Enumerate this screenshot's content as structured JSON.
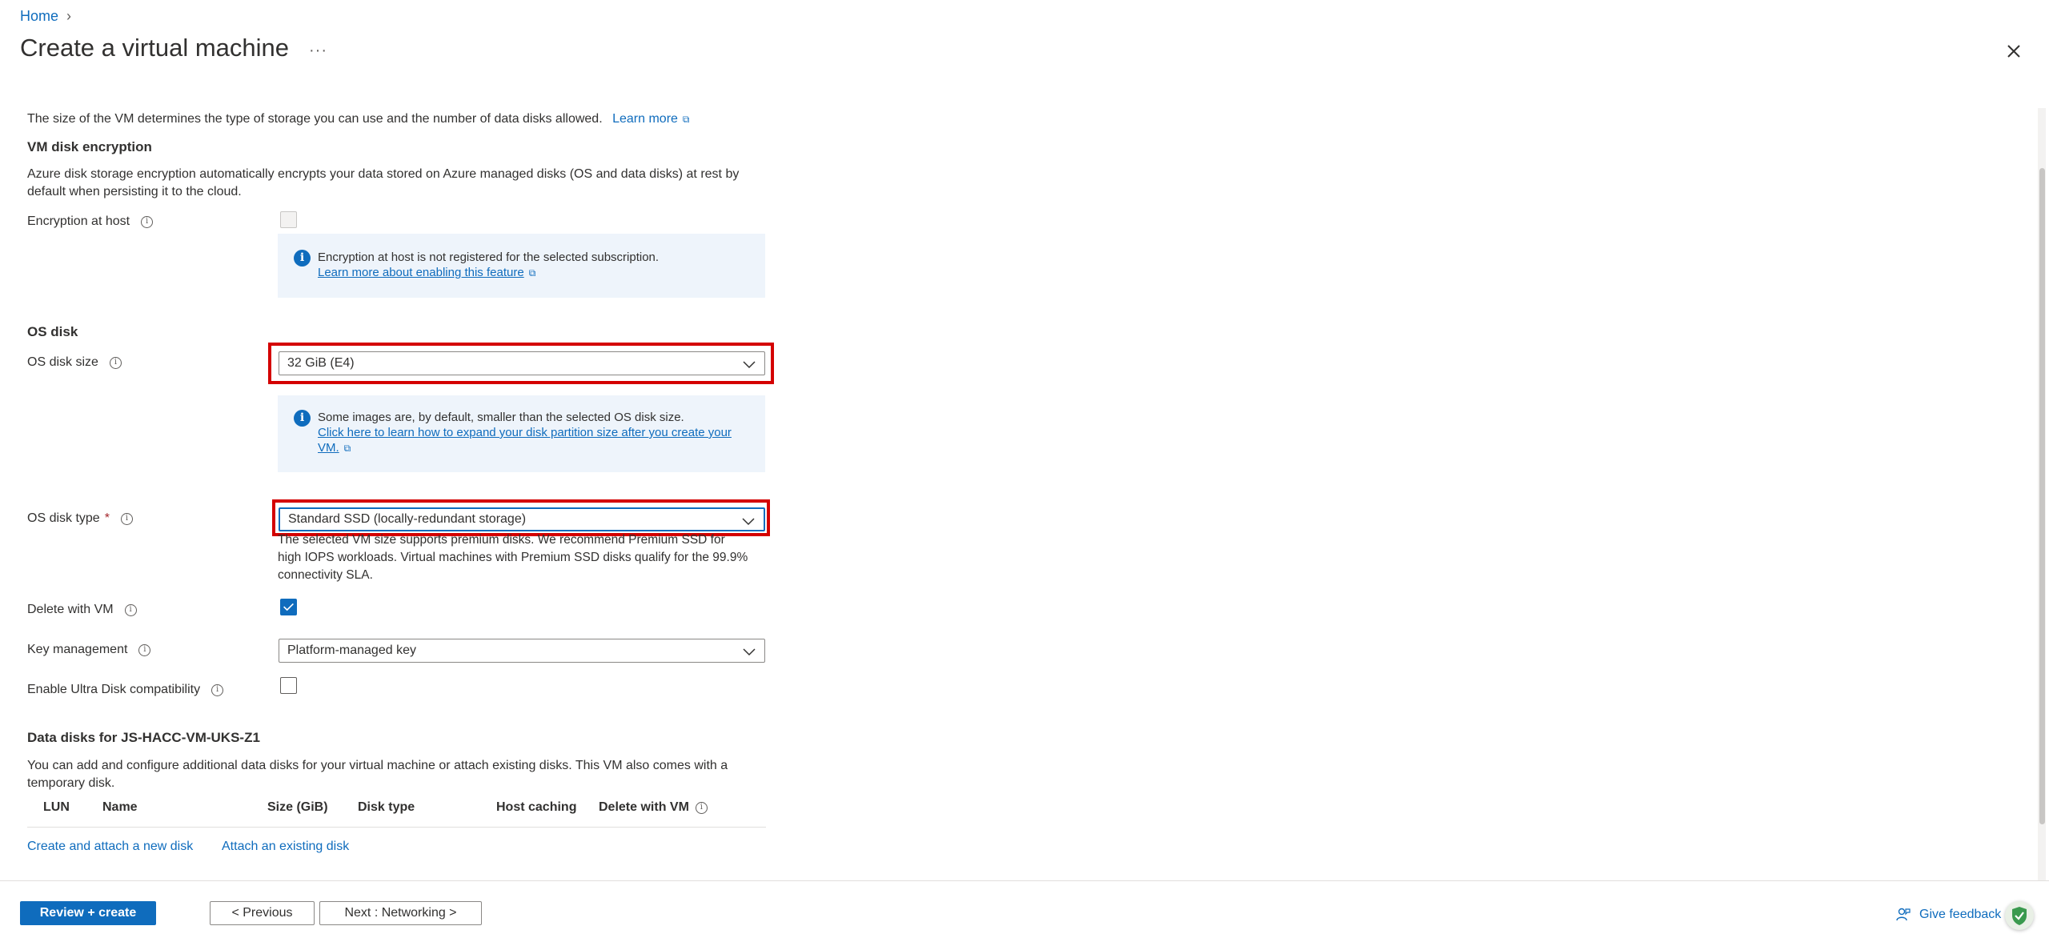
{
  "breadcrumb": {
    "home": "Home"
  },
  "page": {
    "title": "Create a virtual machine",
    "more": "···"
  },
  "intro": {
    "text": "The size of the VM determines the type of storage you can use and the number of data disks allowed.",
    "learn_more": "Learn more"
  },
  "encryption": {
    "heading": "VM disk encryption",
    "desc_line1": "Azure disk storage encryption automatically encrypts your data stored on Azure managed disks (OS and data disks) at rest by",
    "desc_line2": "default when persisting it to the cloud.",
    "host_label": "Encryption at host",
    "info_line1": "Encryption at host is not registered for the selected subscription.",
    "info_link": "Learn more about enabling this feature"
  },
  "os_disk": {
    "heading": "OS disk",
    "size_label": "OS disk size",
    "size_value": "32 GiB (E4)",
    "size_info_line1": "Some images are, by default, smaller than the selected OS disk size.",
    "size_info_link1": "Click here to learn how to expand your disk partition size after you create your",
    "size_info_link2": "VM.",
    "type_label": "OS disk type",
    "type_required": "*",
    "type_value": "Standard SSD (locally-redundant storage)",
    "type_note1": "The selected VM size supports premium disks. We recommend Premium SSD for",
    "type_note2": "high IOPS workloads. Virtual machines with Premium SSD disks qualify for the 99.9%",
    "type_note3": "connectivity SLA.",
    "delete_label": "Delete with VM",
    "delete_checked": true,
    "key_label": "Key management",
    "key_value": "Platform-managed key",
    "ultra_label": "Enable Ultra Disk compatibility",
    "ultra_checked": false
  },
  "data_disks": {
    "heading": "Data disks for JS-HACC-VM-UKS-Z1",
    "desc_line1": "You can add and configure additional data disks for your virtual machine or attach existing disks. This VM also comes with a",
    "desc_line2": "temporary disk.",
    "columns": [
      "LUN",
      "Name",
      "Size (GiB)",
      "Disk type",
      "Host caching",
      "Delete with VM"
    ],
    "create_link": "Create and attach a new disk",
    "attach_link": "Attach an existing disk"
  },
  "footer": {
    "review": "Review + create",
    "previous": "< Previous",
    "next": "Next : Networking >",
    "feedback": "Give feedback"
  },
  "colors": {
    "accent": "#0f6cbd",
    "highlight": "#d40000",
    "info_bg": "#eef4fb"
  }
}
